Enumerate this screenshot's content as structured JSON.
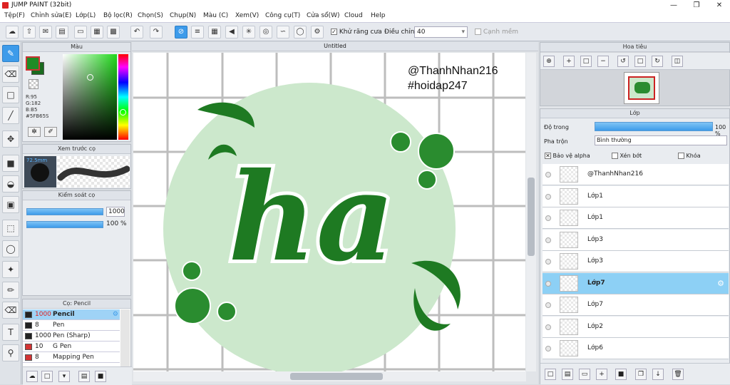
{
  "title_bar": {
    "title": "JUMP PAINT (32bit)"
  },
  "menu": [
    "Tệp(F)",
    "Chỉnh sửa(E)",
    "Lớp(L)",
    "Bộ lọc(R)",
    "Chọn(S)",
    "Chụp(N)",
    "Màu (C)",
    "Xem(V)",
    "Công cụ(T)",
    "Cửa sổ(W)",
    "Cloud",
    "Help"
  ],
  "toolbar": {
    "antialias_label": "Khử răng cưa",
    "adjust_label": "Điều chỉnh",
    "adjust_value": "40",
    "edge_label": "Cạnh mềm"
  },
  "color_panel": {
    "title": "Màu",
    "r": "R:95",
    "g": "G:182",
    "b": "B:B5",
    "hex": "#5FB65S",
    "fg_color": "#1f8c26",
    "bg_color": "#1a6b1f"
  },
  "brush_preview": {
    "title": "Xem trước cọ",
    "size": "72.5mm"
  },
  "brush_control": {
    "title": "Kiểm soát cọ",
    "size_value": "1000",
    "opacity_value": "100 %"
  },
  "brush_list": {
    "title": "Cọ: Pencil",
    "items": [
      {
        "size": "1000",
        "name": "Pencil",
        "color": "#222222"
      },
      {
        "size": "8",
        "name": "Pen",
        "color": "#222222"
      },
      {
        "size": "1000",
        "name": "Pen (Sharp)",
        "color": "#222222"
      },
      {
        "size": "10",
        "name": "G Pen",
        "color": "#d33333"
      },
      {
        "size": "8",
        "name": "Mapping Pen",
        "color": "#d33333"
      }
    ]
  },
  "canvas": {
    "doc_title": "Untitled",
    "credit_line1": "@ThanhNhan216",
    "credit_line2": "#hoidap247",
    "artwork_text": "ha"
  },
  "navigator": {
    "title": "Hoa tiêu"
  },
  "layer_panel": {
    "title": "Lớp",
    "opacity_label": "Độ trong",
    "opacity_value": "100 %",
    "blend_label": "Pha trộn",
    "blend_value": "Bình thường",
    "protect_alpha_label": "Bảo vệ alpha",
    "clip_label": "Xén bớt",
    "lock_label": "Khóa",
    "layers": [
      {
        "name": "@ThanhNhan216"
      },
      {
        "name": "Lớp1"
      },
      {
        "name": "Lớp1"
      },
      {
        "name": "Lớp3"
      },
      {
        "name": "Lớp3"
      },
      {
        "name": "Lớp7",
        "selected": true
      },
      {
        "name": "Lớp7"
      },
      {
        "name": "Lớp2"
      },
      {
        "name": "Lớp6"
      }
    ]
  }
}
